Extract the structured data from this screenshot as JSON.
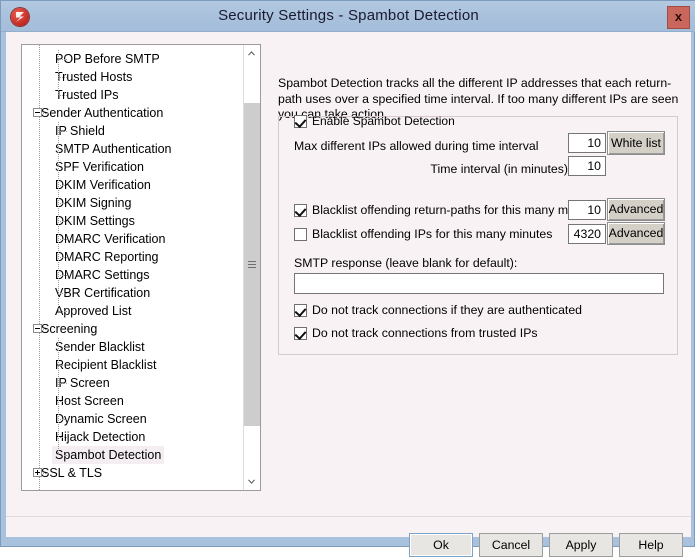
{
  "window": {
    "title": "Security Settings - Spambot Detection",
    "app_icon": "mdaemon-icon",
    "close_label": "x"
  },
  "tree": {
    "items": [
      {
        "label": "POP Before SMTP",
        "level": 1,
        "expander": null,
        "selected": false
      },
      {
        "label": "Trusted Hosts",
        "level": 1,
        "expander": null,
        "selected": false
      },
      {
        "label": "Trusted IPs",
        "level": 1,
        "expander": null,
        "selected": false
      },
      {
        "label": "Sender Authentication",
        "level": 0,
        "expander": "minus",
        "selected": false
      },
      {
        "label": "IP Shield",
        "level": 1,
        "expander": null,
        "selected": false
      },
      {
        "label": "SMTP Authentication",
        "level": 1,
        "expander": null,
        "selected": false
      },
      {
        "label": "SPF Verification",
        "level": 1,
        "expander": null,
        "selected": false
      },
      {
        "label": "DKIM Verification",
        "level": 1,
        "expander": null,
        "selected": false
      },
      {
        "label": "DKIM Signing",
        "level": 1,
        "expander": null,
        "selected": false
      },
      {
        "label": "DKIM Settings",
        "level": 1,
        "expander": null,
        "selected": false
      },
      {
        "label": "DMARC Verification",
        "level": 1,
        "expander": null,
        "selected": false
      },
      {
        "label": "DMARC Reporting",
        "level": 1,
        "expander": null,
        "selected": false
      },
      {
        "label": "DMARC Settings",
        "level": 1,
        "expander": null,
        "selected": false
      },
      {
        "label": "VBR Certification",
        "level": 1,
        "expander": null,
        "selected": false
      },
      {
        "label": "Approved List",
        "level": 1,
        "expander": null,
        "selected": false
      },
      {
        "label": "Screening",
        "level": 0,
        "expander": "minus",
        "selected": false
      },
      {
        "label": "Sender Blacklist",
        "level": 1,
        "expander": null,
        "selected": false
      },
      {
        "label": "Recipient Blacklist",
        "level": 1,
        "expander": null,
        "selected": false
      },
      {
        "label": "IP Screen",
        "level": 1,
        "expander": null,
        "selected": false
      },
      {
        "label": "Host Screen",
        "level": 1,
        "expander": null,
        "selected": false
      },
      {
        "label": "Dynamic Screen",
        "level": 1,
        "expander": null,
        "selected": false
      },
      {
        "label": "Hijack Detection",
        "level": 1,
        "expander": null,
        "selected": false
      },
      {
        "label": "Spambot Detection",
        "level": 1,
        "expander": null,
        "selected": true
      },
      {
        "label": "SSL & TLS",
        "level": 0,
        "expander": "plus",
        "selected": false
      }
    ]
  },
  "panel": {
    "description": "Spambot Detection tracks all the different IP addresses that each return-path uses over a specified time interval.  If too many different IPs are seen you can take action.",
    "enable_checkbox": {
      "label": "Enable Spambot Detection",
      "checked": true
    },
    "max_ips": {
      "label": "Max different IPs allowed during time interval",
      "value": "10"
    },
    "time_interval": {
      "label": "Time interval (in minutes)",
      "value": "10"
    },
    "white_list_button": "White list",
    "blacklist_return_paths": {
      "label": "Blacklist offending return-paths for this many minutes",
      "checked": true,
      "value": "10",
      "button": "Advanced"
    },
    "blacklist_ips": {
      "label": "Blacklist offending IPs for this many minutes",
      "checked": false,
      "value": "4320",
      "button": "Advanced"
    },
    "smtp_response": {
      "label": "SMTP response (leave blank for default):",
      "value": "",
      "placeholder": ""
    },
    "skip_authenticated": {
      "label": "Do not track connections if they are authenticated",
      "checked": true
    },
    "skip_trusted_ips": {
      "label": "Do not track connections from trusted IPs",
      "checked": true
    }
  },
  "buttons": {
    "ok": "Ok",
    "cancel": "Cancel",
    "apply": "Apply",
    "help": "Help"
  }
}
